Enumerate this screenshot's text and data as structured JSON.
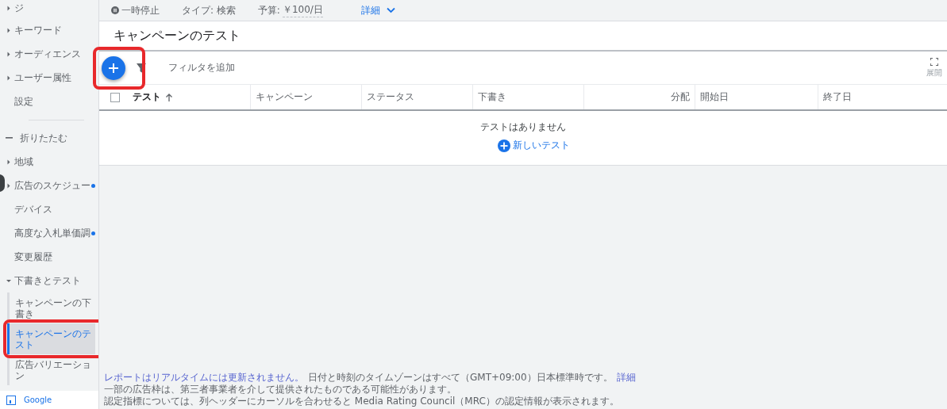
{
  "sidebar": {
    "items": [
      {
        "kind": "group",
        "label": "ジ",
        "expanded": false,
        "flagged": false
      },
      {
        "kind": "group",
        "label": "キーワード",
        "expanded": false,
        "flagged": false
      },
      {
        "kind": "group",
        "label": "オーディエンス",
        "expanded": false,
        "flagged": false
      },
      {
        "kind": "group",
        "label": "ユーザー属性",
        "expanded": false,
        "flagged": false
      },
      {
        "kind": "link",
        "label": "設定",
        "flagged": false
      },
      {
        "kind": "divider"
      },
      {
        "kind": "collapse",
        "label": "折りたたむ"
      },
      {
        "kind": "group",
        "label": "地域",
        "expanded": false,
        "flagged": false
      },
      {
        "kind": "group",
        "label": "広告のスケジュー",
        "expanded": false,
        "flagged": true
      },
      {
        "kind": "link",
        "label": "デバイス",
        "flagged": false
      },
      {
        "kind": "link",
        "label": "高度な入札単価調",
        "flagged": true
      },
      {
        "kind": "link",
        "label": "変更履歴",
        "flagged": false
      },
      {
        "kind": "group",
        "label": "下書きとテスト",
        "expanded": true,
        "flagged": false,
        "children": [
          {
            "label": "キャンペーンの下書き",
            "selected": false
          },
          {
            "label": "キャンペーンのテスト",
            "selected": true
          },
          {
            "label": "広告バリエーション",
            "selected": false
          }
        ]
      }
    ],
    "footer_label": "Google"
  },
  "summary_bar": {
    "status": "一時停止",
    "type": "タイプ: 検索",
    "budget_label": "予算:",
    "budget": "￥100/日",
    "details_link": "詳細"
  },
  "page_title": "キャンペーンのテスト",
  "toolbar": {
    "filter_placeholder": "フィルタを追加",
    "expand_label": "展開"
  },
  "table": {
    "select_all_checked": false,
    "columns": [
      {
        "label": "テスト",
        "sorted": true
      },
      {
        "label": "キャンペーン",
        "sorted": false
      },
      {
        "label": "ステータス",
        "sorted": false
      },
      {
        "label": "下書き",
        "sorted": false
      },
      {
        "label": "分配",
        "sorted": false
      },
      {
        "label": "開始日",
        "sorted": false
      },
      {
        "label": "終了日",
        "sorted": false
      }
    ],
    "empty_message": "テストはありません",
    "new_button": "新しいテスト"
  },
  "footer": {
    "notice_link": "レポートはリアルタイムには更新されません。",
    "timezone_note": "日付と時刻のタイムゾーンはすべて（GMT+09:00）日本標準時です。",
    "details_link": "詳細",
    "lines": [
      "一部の広告枠は、第三者事業者を介して提供されたものである可能性があります。",
      "認定指標については、列ヘッダーにカーソルを合わせると Media Rating Council（MRC）の認定情報が表示されます。"
    ]
  }
}
